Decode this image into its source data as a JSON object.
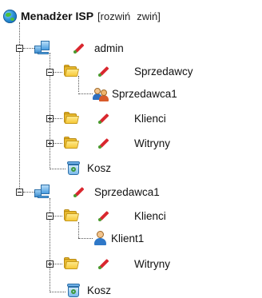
{
  "header": {
    "title": "Menadżer ISP",
    "bracket_open": "[",
    "expand_label": "rozwiń",
    "collapse_label": "zwiń",
    "bracket_close": "]"
  },
  "tree": {
    "admin": {
      "label": "admin",
      "sprzedawcy": {
        "label": "Sprzedawcy",
        "child": "Sprzedawca1"
      },
      "klienci": "Klienci",
      "witryny": "Witryny",
      "kosz": "Kosz"
    },
    "reseller": {
      "label": "Sprzedawca1",
      "klienci": {
        "label": "Klienci",
        "child": "Klient1"
      },
      "witryny": "Witryny",
      "kosz": "Kosz"
    }
  },
  "icons": [
    "globe-icon",
    "server-icon",
    "folder-icon",
    "edit-pencil-icon",
    "users-icon",
    "user-icon",
    "recycle-bin-icon"
  ]
}
